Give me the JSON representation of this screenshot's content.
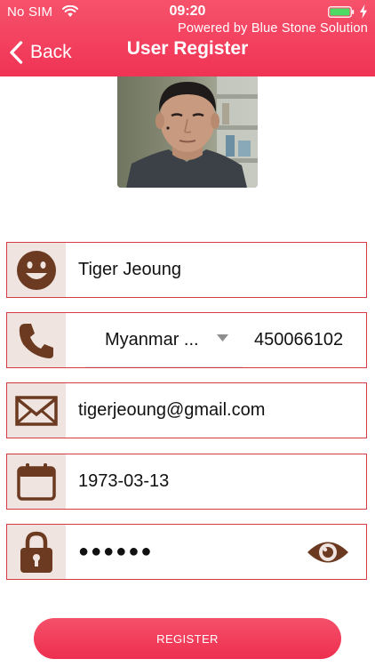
{
  "status_bar": {
    "carrier": "No SIM",
    "time": "09:20",
    "powered_by": "Powered by Blue Stone Solution"
  },
  "nav": {
    "back_label": "Back",
    "title": "User Register"
  },
  "form": {
    "name": "Tiger Jeoung",
    "country": "Myanmar ...",
    "phone": "450066102",
    "email": "tigerjeoung@gmail.com",
    "birthdate": "1973-03-13",
    "password_mask": "●●●●●●"
  },
  "register_label": "REGISTER",
  "colors": {
    "header_accent": "#f03354",
    "field_border": "#d63a44",
    "icon_brown": "#6b3a20",
    "icon_box_bg": "#efe4df"
  },
  "icons": {
    "name": "smiley-face-icon",
    "phone": "phone-icon",
    "email": "envelope-icon",
    "birthdate": "calendar-icon",
    "password": "padlock-icon",
    "show_password": "eye-icon"
  }
}
